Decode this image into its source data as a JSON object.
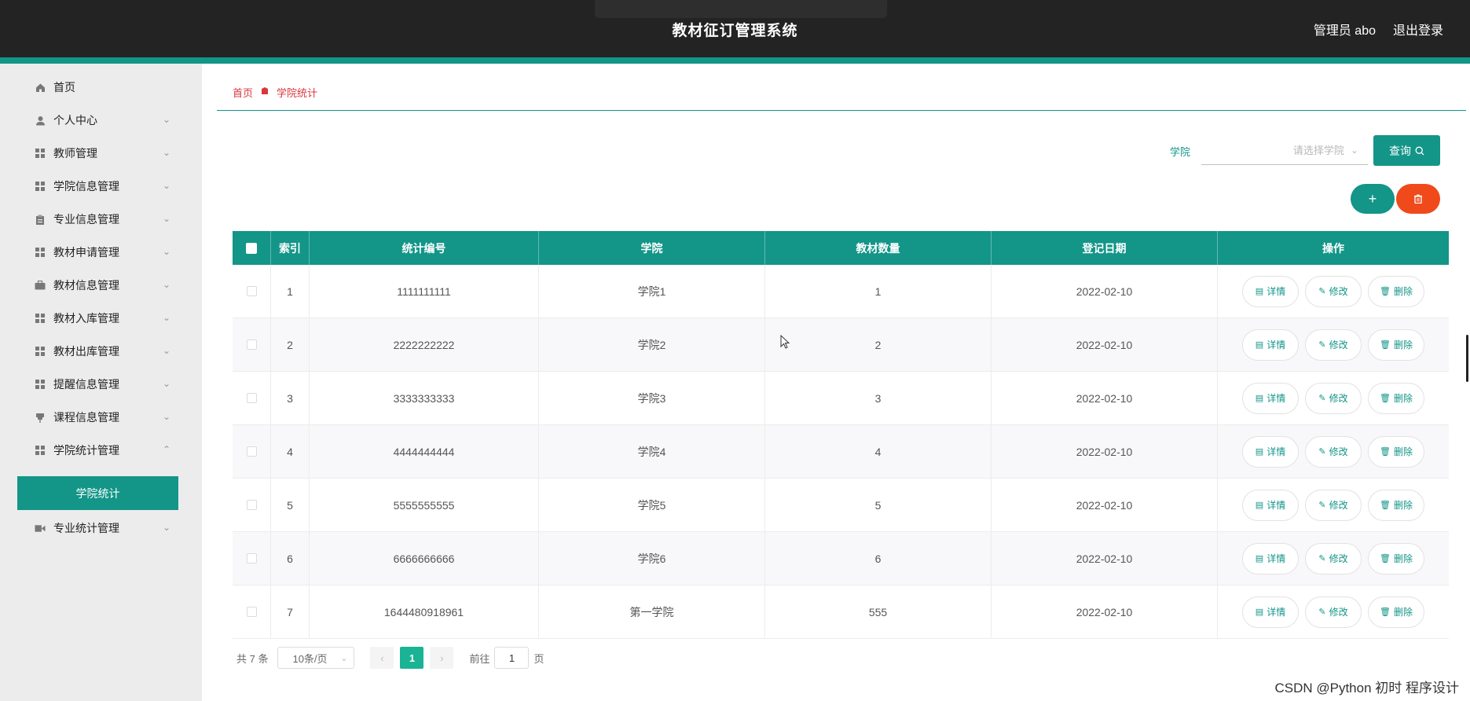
{
  "header": {
    "title": "教材征订管理系统",
    "user_label": "管理员 abo",
    "logout_label": "退出登录"
  },
  "sidebar": {
    "items": [
      {
        "label": "首页",
        "icon": "home-icon"
      },
      {
        "label": "个人中心",
        "icon": "user-icon"
      },
      {
        "label": "教师管理",
        "icon": "grid-icon"
      },
      {
        "label": "学院信息管理",
        "icon": "grid-icon"
      },
      {
        "label": "专业信息管理",
        "icon": "clipboard-icon"
      },
      {
        "label": "教材申请管理",
        "icon": "grid-icon"
      },
      {
        "label": "教材信息管理",
        "icon": "briefcase-icon"
      },
      {
        "label": "教材入库管理",
        "icon": "grid-icon"
      },
      {
        "label": "教材出库管理",
        "icon": "grid-icon"
      },
      {
        "label": "提醒信息管理",
        "icon": "grid-icon"
      },
      {
        "label": "课程信息管理",
        "icon": "pin-icon"
      },
      {
        "label": "学院统计管理",
        "icon": "grid-icon"
      },
      {
        "label": "专业统计管理",
        "icon": "video-icon"
      }
    ],
    "active_sub_item": "学院统计"
  },
  "breadcrumb": {
    "home": "首页",
    "current": "学院统计"
  },
  "filter": {
    "label": "学院",
    "placeholder": "请选择学院",
    "search_label": "查询"
  },
  "table": {
    "columns": [
      "索引",
      "统计编号",
      "学院",
      "教材数量",
      "登记日期",
      "操作"
    ],
    "rows": [
      {
        "index": "1",
        "code": "1111111111",
        "college": "学院1",
        "count": "1",
        "date": "2022-02-10"
      },
      {
        "index": "2",
        "code": "2222222222",
        "college": "学院2",
        "count": "2",
        "date": "2022-02-10"
      },
      {
        "index": "3",
        "code": "3333333333",
        "college": "学院3",
        "count": "3",
        "date": "2022-02-10"
      },
      {
        "index": "4",
        "code": "4444444444",
        "college": "学院4",
        "count": "4",
        "date": "2022-02-10"
      },
      {
        "index": "5",
        "code": "5555555555",
        "college": "学院5",
        "count": "5",
        "date": "2022-02-10"
      },
      {
        "index": "6",
        "code": "6666666666",
        "college": "学院6",
        "count": "6",
        "date": "2022-02-10"
      },
      {
        "index": "7",
        "code": "1644480918961",
        "college": "第一学院",
        "count": "555",
        "date": "2022-02-10"
      }
    ],
    "actions": {
      "detail": "详情",
      "edit": "修改",
      "delete": "删除"
    }
  },
  "pagination": {
    "total": "共 7 条",
    "page_size": "10条/页",
    "current_page": "1",
    "goto_prefix": "前往",
    "goto_value": "1",
    "goto_suffix": "页"
  },
  "watermark": "CSDN @Python 初时 程序设计",
  "colors": {
    "accent": "#139588",
    "danger": "#f04a1b",
    "breadcrumb": "#d9363e"
  }
}
